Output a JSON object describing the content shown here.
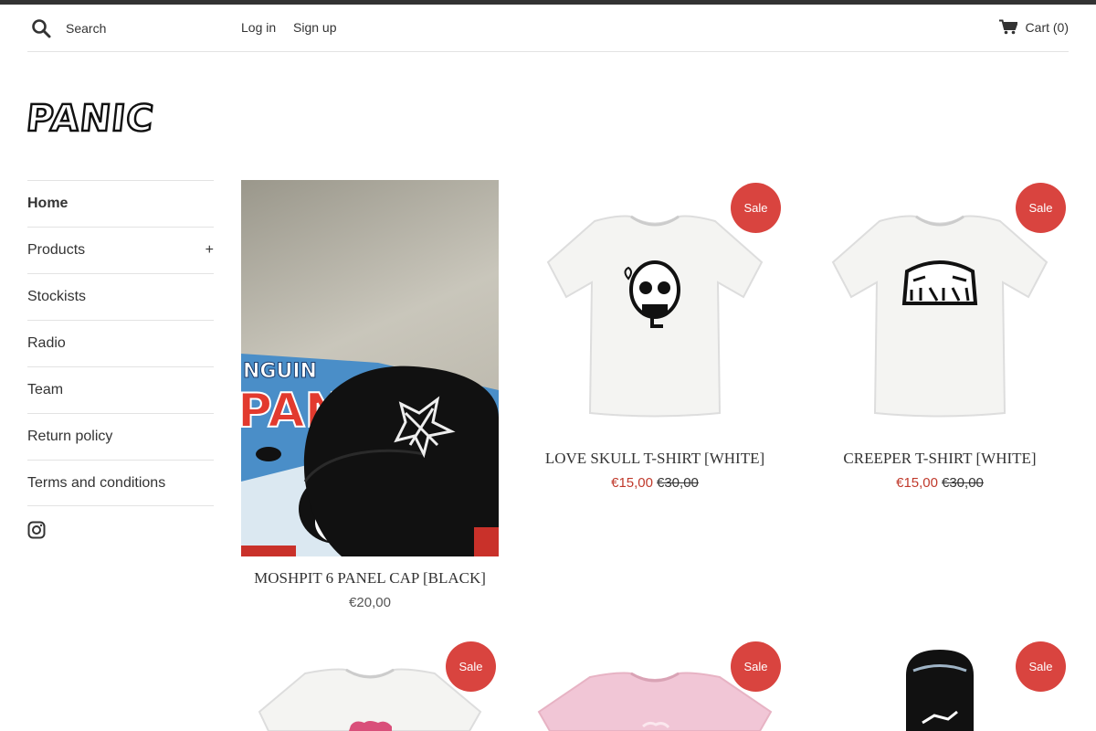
{
  "header": {
    "search_placeholder": "Search",
    "login_label": "Log in",
    "signup_label": "Sign up",
    "cart_label": "Cart (0)"
  },
  "logo": {
    "text": "PANIC"
  },
  "sidebar": {
    "items": [
      {
        "label": "Home",
        "active": true
      },
      {
        "label": "Products",
        "expand": "+"
      },
      {
        "label": "Stockists"
      },
      {
        "label": "Radio"
      },
      {
        "label": "Team"
      },
      {
        "label": "Return policy"
      },
      {
        "label": "Terms and conditions"
      }
    ],
    "social_icon": "instagram-icon"
  },
  "products": [
    {
      "title": "MOSHPIT 6 PANEL CAP [BLACK]",
      "price": "€20,00"
    },
    {
      "title": "LOVE SKULL T-SHIRT [WHITE]",
      "sale_price": "€15,00",
      "old_price": "€30,00",
      "badge": "Sale"
    },
    {
      "title": "CREEPER T-SHIRT [WHITE]",
      "sale_price": "€15,00",
      "old_price": "€30,00",
      "badge": "Sale"
    },
    {
      "badge": "Sale"
    },
    {
      "badge": "Sale"
    },
    {
      "badge": "Sale"
    }
  ],
  "colors": {
    "sale_badge": "#d9443f",
    "sale_price": "#c0392b",
    "topbar": "#333333"
  }
}
